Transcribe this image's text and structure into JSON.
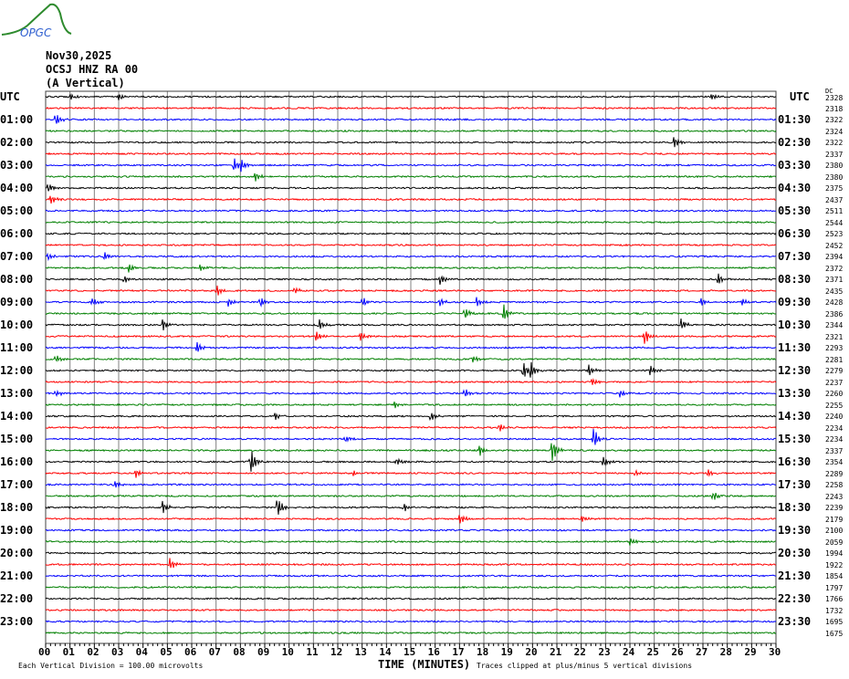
{
  "header": {
    "logo_text": "OPGC",
    "date": "Nov30,2025",
    "station": "OCSJ HNZ RA 00",
    "component": "(A Vertical)",
    "left_utc": "UTC",
    "right_utc": "UTC",
    "right_unit": "DC"
  },
  "colors": {
    "trace_cycle": [
      "#000000",
      "#ff0000",
      "#0000ff",
      "#008000"
    ],
    "grid": "#808080"
  },
  "footer": {
    "scale": "Each Vertical Division =  100.00 microvolts",
    "xlabel": "TIME (MINUTES)",
    "clip_note": "Traces clipped at plus/minus 5 vertical divisions"
  },
  "chart_data": {
    "type": "line",
    "title": "OCSJ HNZ RA 00 (A Vertical) Nov30,2025",
    "xlabel": "TIME (MINUTES)",
    "xlim": [
      0,
      30
    ],
    "x_ticks": [
      "00",
      "01",
      "02",
      "03",
      "04",
      "05",
      "06",
      "07",
      "08",
      "09",
      "10",
      "11",
      "12",
      "13",
      "14",
      "15",
      "16",
      "17",
      "18",
      "19",
      "20",
      "21",
      "22",
      "23",
      "24",
      "25",
      "26",
      "27",
      "28",
      "29",
      "30"
    ],
    "left_labels": [
      "01:00",
      "02:00",
      "03:00",
      "04:00",
      "05:00",
      "06:00",
      "07:00",
      "08:00",
      "09:00",
      "10:00",
      "11:00",
      "12:00",
      "13:00",
      "14:00",
      "15:00",
      "16:00",
      "17:00",
      "18:00",
      "19:00",
      "20:00",
      "21:00",
      "22:00",
      "23:00"
    ],
    "right_labels": [
      "01:30",
      "02:30",
      "03:30",
      "04:30",
      "05:30",
      "06:30",
      "07:30",
      "08:30",
      "09:30",
      "10:30",
      "11:30",
      "12:30",
      "13:30",
      "14:30",
      "15:30",
      "16:30",
      "17:30",
      "18:30",
      "19:30",
      "20:30",
      "21:30",
      "22:30",
      "23:30"
    ],
    "dc_offsets": [
      2328,
      2318,
      2322,
      2324,
      2322,
      2337,
      2380,
      2380,
      2375,
      2437,
      2511,
      2544,
      2523,
      2452,
      2394,
      2372,
      2371,
      2435,
      2428,
      2386,
      2344,
      2321,
      2293,
      2281,
      2279,
      2237,
      2260,
      2255,
      2240,
      2234,
      2234,
      2337,
      2354,
      2289,
      2258,
      2243,
      2239,
      2179,
      2100,
      2059,
      1994,
      1922,
      1854,
      1797,
      1766,
      1732,
      1695,
      1675
    ],
    "events": [
      [
        0,
        1.0,
        4
      ],
      [
        0,
        3.0,
        4
      ],
      [
        0,
        27.3,
        4
      ],
      [
        2,
        0.4,
        9
      ],
      [
        4,
        25.8,
        7
      ],
      [
        6,
        7.7,
        10
      ],
      [
        6,
        8.0,
        8
      ],
      [
        7,
        8.6,
        6
      ],
      [
        8,
        0.1,
        6
      ],
      [
        9,
        0.2,
        6
      ],
      [
        14,
        0.1,
        5
      ],
      [
        14,
        2.4,
        5
      ],
      [
        15,
        3.4,
        5
      ],
      [
        15,
        6.3,
        5
      ],
      [
        16,
        3.2,
        6
      ],
      [
        16,
        16.2,
        7
      ],
      [
        16,
        27.6,
        7
      ],
      [
        17,
        7.0,
        8
      ],
      [
        17,
        10.2,
        5
      ],
      [
        18,
        1.9,
        5
      ],
      [
        18,
        7.5,
        5
      ],
      [
        18,
        8.8,
        7
      ],
      [
        18,
        13.0,
        6
      ],
      [
        18,
        16.2,
        5
      ],
      [
        18,
        17.7,
        6
      ],
      [
        18,
        26.9,
        5
      ],
      [
        18,
        28.6,
        4
      ],
      [
        19,
        17.2,
        8
      ],
      [
        19,
        18.8,
        11
      ],
      [
        20,
        4.8,
        7
      ],
      [
        20,
        11.2,
        8
      ],
      [
        20,
        26.1,
        7
      ],
      [
        21,
        11.1,
        6
      ],
      [
        21,
        12.9,
        6
      ],
      [
        21,
        24.6,
        10
      ],
      [
        22,
        6.2,
        7
      ],
      [
        23,
        0.4,
        5
      ],
      [
        23,
        17.5,
        6
      ],
      [
        24,
        19.6,
        11
      ],
      [
        24,
        19.9,
        11
      ],
      [
        24,
        22.3,
        7
      ],
      [
        24,
        24.8,
        7
      ],
      [
        25,
        22.4,
        5
      ],
      [
        26,
        0.4,
        5
      ],
      [
        26,
        17.2,
        6
      ],
      [
        26,
        23.6,
        5
      ],
      [
        27,
        14.3,
        5
      ],
      [
        28,
        9.4,
        5
      ],
      [
        28,
        15.8,
        7
      ],
      [
        29,
        18.6,
        6
      ],
      [
        30,
        12.3,
        5
      ],
      [
        30,
        22.5,
        14
      ],
      [
        31,
        17.8,
        7
      ],
      [
        31,
        20.8,
        15
      ],
      [
        32,
        8.4,
        18
      ],
      [
        32,
        14.4,
        6
      ],
      [
        32,
        22.9,
        7
      ],
      [
        33,
        3.7,
        5
      ],
      [
        33,
        12.6,
        5
      ],
      [
        33,
        24.2,
        5
      ],
      [
        33,
        27.2,
        5
      ],
      [
        34,
        2.8,
        6
      ],
      [
        35,
        27.4,
        6
      ],
      [
        36,
        4.8,
        8
      ],
      [
        36,
        9.5,
        14
      ],
      [
        36,
        14.7,
        7
      ],
      [
        37,
        17.0,
        6
      ],
      [
        37,
        22.0,
        5
      ],
      [
        39,
        24.0,
        5
      ],
      [
        41,
        5.1,
        7
      ]
    ]
  }
}
